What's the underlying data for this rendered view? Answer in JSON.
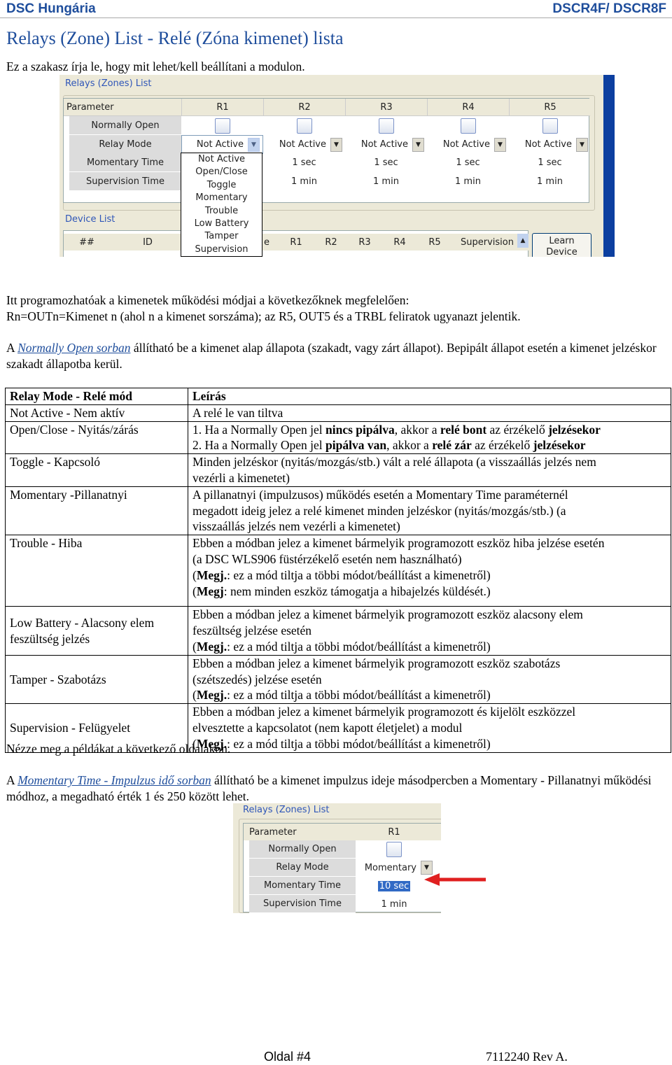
{
  "header": {
    "left": "DSC Hungária",
    "right": "DSCR4F/ DSCR8F"
  },
  "title": "Relays (Zone) List - Relé (Zóna kimenet) lista",
  "intro": "Ez a szakasz írja le, hogy mit lehet/kell beállítani a modulon.",
  "screenshot1": {
    "group_title": "Relays (Zones) List",
    "param_header": "Parameter",
    "columns": [
      "R1",
      "R2",
      "R3",
      "R4",
      "R5"
    ],
    "params": [
      "Normally Open",
      "Relay Mode",
      "Momentary Time",
      "Supervision Time"
    ],
    "relay_mode_value": "Not Active",
    "momentary_time": "1 sec",
    "supervision_time": "1 min",
    "dropdown_options": [
      "Not Active",
      "Open/Close",
      "Toggle",
      "Momentary",
      "Trouble",
      "Low Battery",
      "Tamper",
      "Supervision"
    ],
    "device_group_title": "Device List",
    "device_columns": [
      "##",
      "ID",
      "e",
      "R1",
      "R2",
      "R3",
      "R4",
      "R5",
      "Supervision"
    ],
    "learn_button": "Learn Device"
  },
  "para1": [
    "Itt programozhatóak a kimenetek működési módjai a következőknek megfelelően:",
    "Rn=OUTn=Kimenet n (ahol n a kimenet sorszáma); az R5, OUT5 és a TRBL feliratok ugyanazt jelentik."
  ],
  "para2": {
    "pre": "A ",
    "link": "Normally Open sorban",
    "post": " állítható be a kimenet alap állapota (szakadt, vagy zárt állapot). Bepipált állapot esetén a kimenet jelzéskor szakadt állapotba kerül."
  },
  "table": {
    "headers": [
      "Relay Mode - Relé mód",
      "Leírás"
    ],
    "rows": [
      {
        "mode": "Not Active - Nem aktív",
        "desc": [
          [
            [
              "A relé le van tiltva",
              0
            ]
          ]
        ]
      },
      {
        "mode": "Open/Close - Nyitás/zárás",
        "desc": [
          [
            [
              "1. Ha a Normally Open jel ",
              0
            ],
            [
              "nincs pipálva",
              1
            ],
            [
              ", akkor a ",
              0
            ],
            [
              "relé bont",
              1
            ],
            [
              " az érzékelő ",
              0
            ],
            [
              "jelzésekor",
              1
            ]
          ],
          [
            [
              "2. Ha a Normally Open jel ",
              0
            ],
            [
              "pipálva van",
              1
            ],
            [
              ", akkor a ",
              0
            ],
            [
              "relé zár",
              1
            ],
            [
              " az érzékelő ",
              0
            ],
            [
              "jelzésekor",
              1
            ]
          ]
        ]
      },
      {
        "mode": "Toggle - Kapcsoló",
        "desc": [
          [
            [
              "Minden jelzéskor (nyitás/mozgás/stb.) vált a relé állapota (a visszaállás jelzés nem",
              0
            ]
          ],
          [
            [
              "vezérli a kimenetet)",
              0
            ]
          ]
        ]
      },
      {
        "mode": "Momentary -Pillanatnyi",
        "desc": [
          [
            [
              "A pillanatnyi (impulzusos) működés esetén a Momentary Time paraméternél",
              0
            ]
          ],
          [
            [
              "megadott ideig jelez a relé kimenet minden jelzéskor (nyitás/mozgás/stb.) (a",
              0
            ]
          ],
          [
            [
              "visszaállás jelzés nem vezérli a kimenetet)",
              0
            ]
          ]
        ]
      },
      {
        "mode": "Trouble - Hiba",
        "desc": [
          [
            [
              "Ebben a módban jelez a kimenet bármelyik programozott eszköz hiba jelzése esetén",
              0
            ]
          ],
          [
            [
              "(a DSC WLS906 füstérzékelő esetén nem használható)",
              0
            ]
          ],
          [
            [
              "(",
              0
            ],
            [
              "Megj.",
              1
            ],
            [
              ": ez a mód tiltja a többi módot/beállítást a kimenetről)",
              0
            ]
          ],
          [
            [
              "(",
              0
            ],
            [
              "Megj",
              1
            ],
            [
              ": nem minden eszköz támogatja a hibajelzés küldését.)",
              0
            ]
          ]
        ]
      },
      {
        "mode": "Low Battery - Alacsony elem feszültség jelzés",
        "desc": [
          [
            [
              "Ebben a módban jelez a kimenet bármelyik programozott eszköz alacsony elem",
              0
            ]
          ],
          [
            [
              "feszültség jelzése esetén",
              0
            ]
          ],
          [
            [
              "(",
              0
            ],
            [
              "Megj.",
              1
            ],
            [
              ": ez a mód tiltja a többi módot/beállítást a kimenetről)",
              0
            ]
          ]
        ]
      },
      {
        "mode": "Tamper - Szabotázs",
        "desc": [
          [
            [
              "Ebben a módban jelez a kimenet bármelyik programozott eszköz szabotázs",
              0
            ]
          ],
          [
            [
              "(szétszedés) jelzése esetén",
              0
            ]
          ],
          [
            [
              "(",
              0
            ],
            [
              "Megj.",
              1
            ],
            [
              ": ez a mód tiltja a többi módot/beállítást a kimenetről)",
              0
            ]
          ]
        ]
      },
      {
        "mode": "Supervision - Felügyelet",
        "desc": [
          [
            [
              "Ebben a módban jelez a kimenet bármelyik programozott és kijelölt eszközzel",
              0
            ]
          ],
          [
            [
              "elvesztette a kapcsolatot (nem kapott életjelet) a modul",
              0
            ]
          ],
          [
            [
              "(",
              0
            ],
            [
              "Megj.",
              1
            ],
            [
              ": ez a mód tiltja a többi módot/beállítást a kimenetről)",
              0
            ]
          ]
        ]
      }
    ]
  },
  "note": "Nézze meg a példákat a következő oldalakon.",
  "para3": {
    "pre": "A ",
    "link": "Momentary Time - Impulzus idő sorban",
    "post": " állítható be a kimenet impulzus ideje másodpercben a Momentary - Pillanatnyi működési módhoz, a megadható érték 1 és 250 között lehet."
  },
  "screenshot2": {
    "group_title": "Relays (Zones) List",
    "param_header": "Parameter",
    "column": "R1",
    "params": [
      "Normally Open",
      "Relay Mode",
      "Momentary Time",
      "Supervision Time"
    ],
    "relay_mode_value": "Momentary",
    "momentary_time": "10 sec",
    "supervision_time": "1 min",
    "arrow_color": "#e02020",
    "highlight_color": "#316ac5"
  },
  "footer": {
    "page": "Oldal #4",
    "rev": "7112240 Rev A."
  }
}
